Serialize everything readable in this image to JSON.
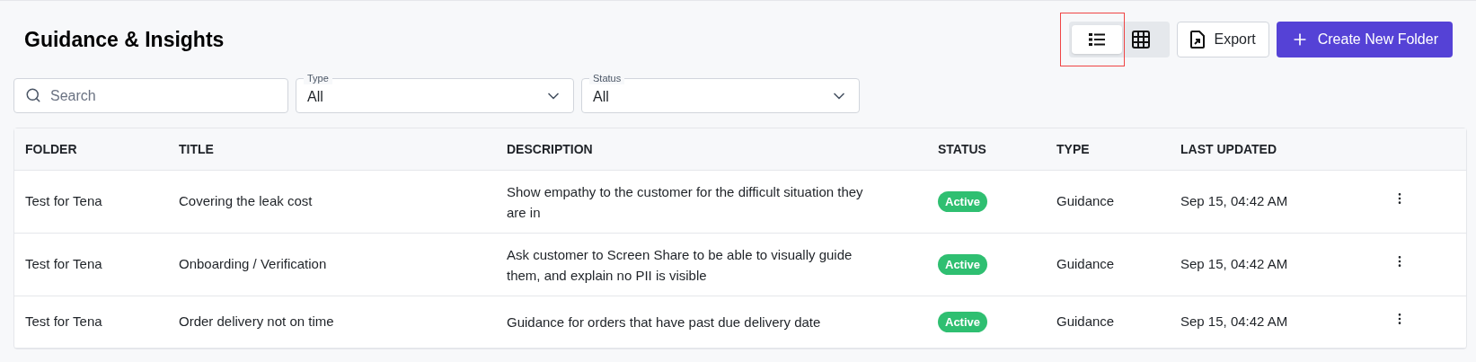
{
  "page_title": "Guidance & Insights",
  "view_toggle": [
    {
      "kind": "list",
      "selected": true,
      "highlighted": true
    },
    {
      "kind": "grid",
      "selected": false,
      "highlighted": false
    }
  ],
  "export_button": "Export",
  "create_button": "Create New Folder",
  "filters": {
    "search": {
      "placeholder": "Search"
    },
    "selects": [
      {
        "label": "Type",
        "value": "All"
      },
      {
        "label": "Status",
        "value": "All"
      }
    ]
  },
  "table": {
    "columns": [
      "FOLDER",
      "TITLE",
      "DESCRIPTION",
      "STATUS",
      "TYPE",
      "LAST UPDATED"
    ],
    "rows": [
      {
        "folder": "Test for Tena",
        "title": "Covering the leak cost",
        "description": "Show empathy to the customer for the difficult situation they are in",
        "status": "Active",
        "type": "Guidance",
        "last_updated": "Sep 15, 04:42 AM"
      },
      {
        "folder": "Test for Tena",
        "title": "Onboarding / Verification",
        "description": "Ask customer to Screen Share to be able to visually guide them, and explain no PII is visible",
        "status": "Active",
        "type": "Guidance",
        "last_updated": "Sep 15, 04:42 AM"
      },
      {
        "folder": "Test for Tena",
        "title": "Order delivery not on time",
        "description": "Guidance for orders that have past due delivery date",
        "status": "Active",
        "type": "Guidance",
        "last_updated": "Sep 15, 04:42 AM"
      }
    ]
  }
}
